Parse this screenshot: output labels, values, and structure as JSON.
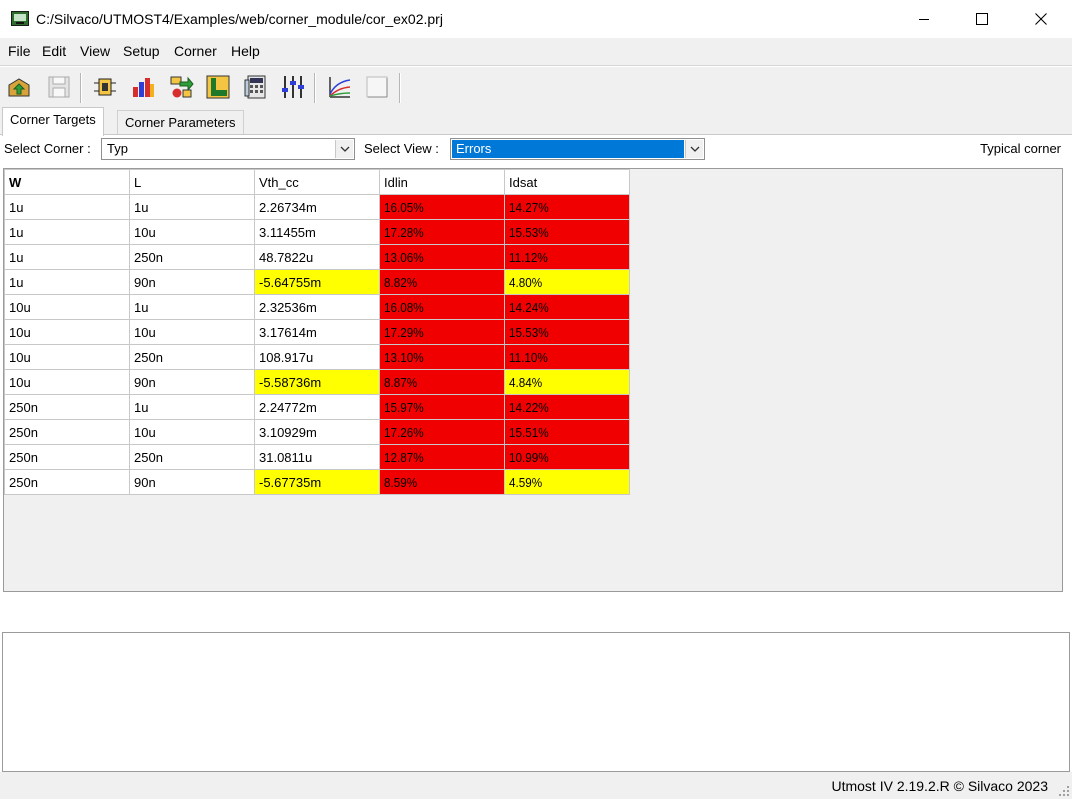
{
  "window": {
    "title": "C:/Silvaco/UTMOST4/Examples/web/corner_module/cor_ex02.prj",
    "app_icon": "app-monitor-icon",
    "controls": [
      "minimize-icon",
      "maximize-icon",
      "close-icon"
    ]
  },
  "menu": {
    "items": [
      "File",
      "Edit",
      "View",
      "Setup",
      "Corner",
      "Help"
    ]
  },
  "toolbar": {
    "buttons": [
      "open-project-icon",
      "save-icon",
      "module-icon",
      "bar-chart-icon",
      "move-data-icon",
      "layout-icon",
      "calculator-icon",
      "sliders-icon",
      "plot-icon",
      "blank-page-icon"
    ]
  },
  "tabs": [
    "Corner Targets",
    "Corner Parameters"
  ],
  "selectors": {
    "corner_label": "Select Corner :",
    "corner_value": "Typ",
    "view_label": "Select View :",
    "view_value": "Errors",
    "right_label": "Typical corner"
  },
  "colors": {
    "error_high": "#f00000",
    "error_medium": "#ffff00",
    "selection": "#0078d7"
  },
  "table": {
    "columns": [
      "W",
      "L",
      "Vth_cc",
      "Idlin",
      "Idsat"
    ],
    "rows": [
      {
        "W": "1u",
        "L": "1u",
        "Vth_cc": "2.26734m",
        "Idlin": "16.05%",
        "Idsat": "14.27%",
        "colors": [
          "",
          "",
          "",
          "red",
          "red"
        ]
      },
      {
        "W": "1u",
        "L": "10u",
        "Vth_cc": "3.11455m",
        "Idlin": "17.28%",
        "Idsat": "15.53%",
        "colors": [
          "",
          "",
          "",
          "red",
          "red"
        ]
      },
      {
        "W": "1u",
        "L": "250n",
        "Vth_cc": "48.7822u",
        "Idlin": "13.06%",
        "Idsat": "11.12%",
        "colors": [
          "",
          "",
          "",
          "red",
          "red"
        ]
      },
      {
        "W": "1u",
        "L": "90n",
        "Vth_cc": "-5.64755m",
        "Idlin": "8.82%",
        "Idsat": "4.80%",
        "colors": [
          "",
          "",
          "yellow",
          "red",
          "yellow"
        ]
      },
      {
        "W": "10u",
        "L": "1u",
        "Vth_cc": "2.32536m",
        "Idlin": "16.08%",
        "Idsat": "14.24%",
        "colors": [
          "",
          "",
          "",
          "red",
          "red"
        ]
      },
      {
        "W": "10u",
        "L": "10u",
        "Vth_cc": "3.17614m",
        "Idlin": "17.29%",
        "Idsat": "15.53%",
        "colors": [
          "",
          "",
          "",
          "red",
          "red"
        ]
      },
      {
        "W": "10u",
        "L": "250n",
        "Vth_cc": "108.917u",
        "Idlin": "13.10%",
        "Idsat": "11.10%",
        "colors": [
          "",
          "",
          "",
          "red",
          "red"
        ]
      },
      {
        "W": "10u",
        "L": "90n",
        "Vth_cc": "-5.58736m",
        "Idlin": "8.87%",
        "Idsat": "4.84%",
        "colors": [
          "",
          "",
          "yellow",
          "red",
          "yellow"
        ]
      },
      {
        "W": "250n",
        "L": "1u",
        "Vth_cc": "2.24772m",
        "Idlin": "15.97%",
        "Idsat": "14.22%",
        "colors": [
          "",
          "",
          "",
          "red",
          "red"
        ]
      },
      {
        "W": "250n",
        "L": "10u",
        "Vth_cc": "3.10929m",
        "Idlin": "17.26%",
        "Idsat": "15.51%",
        "colors": [
          "",
          "",
          "",
          "red",
          "red"
        ]
      },
      {
        "W": "250n",
        "L": "250n",
        "Vth_cc": "31.0811u",
        "Idlin": "12.87%",
        "Idsat": "10.99%",
        "colors": [
          "",
          "",
          "",
          "red",
          "red"
        ]
      },
      {
        "W": "250n",
        "L": "90n",
        "Vth_cc": "-5.67735m",
        "Idlin": "8.59%",
        "Idsat": "4.59%",
        "colors": [
          "",
          "",
          "yellow",
          "red",
          "yellow"
        ]
      }
    ]
  },
  "status": {
    "text": "Utmost IV 2.19.2.R © Silvaco 2023"
  }
}
